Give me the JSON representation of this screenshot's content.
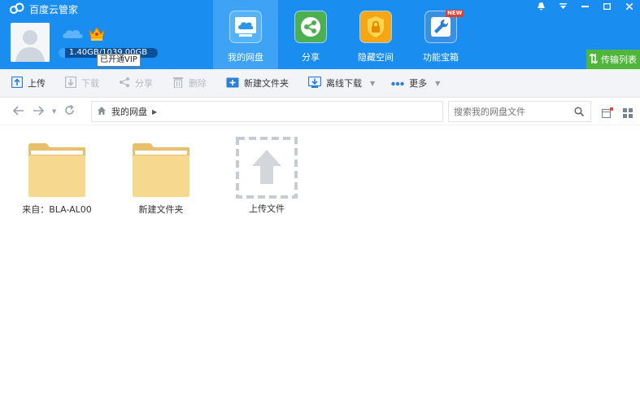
{
  "app": {
    "title": "百度云管家"
  },
  "user": {
    "quota_text": "1.40GB/1039.00GB",
    "quota_used_fraction": 0.0013,
    "vip_tooltip": "已开通VIP"
  },
  "nav": {
    "items": [
      {
        "label": "我的网盘",
        "icon": "cloud-drive-icon",
        "active": true
      },
      {
        "label": "分享",
        "icon": "share-icon"
      },
      {
        "label": "隐藏空间",
        "icon": "lock-icon"
      },
      {
        "label": "功能宝箱",
        "icon": "wrench-icon",
        "badge": "NEW"
      }
    ]
  },
  "window": {
    "transfer_label": "传输列表"
  },
  "toolbar": {
    "upload": "上传",
    "download": "下载",
    "share": "分享",
    "delete": "删除",
    "new_folder": "新建文件夹",
    "offline_download": "离线下载",
    "more": "更多"
  },
  "addressbar": {
    "path": "我的网盘",
    "search_placeholder": "搜索我的网盘文件"
  },
  "files": [
    {
      "name": "来自：BLA-AL00",
      "type": "folder"
    },
    {
      "name": "新建文件夹",
      "type": "folder"
    },
    {
      "name": "上传文件",
      "type": "upload"
    }
  ],
  "colors": {
    "header_bg": "#1a8df0",
    "nav_active": "#3ea2f5",
    "transfer_btn": "#4fb53b",
    "folder": "#f7d88f"
  }
}
